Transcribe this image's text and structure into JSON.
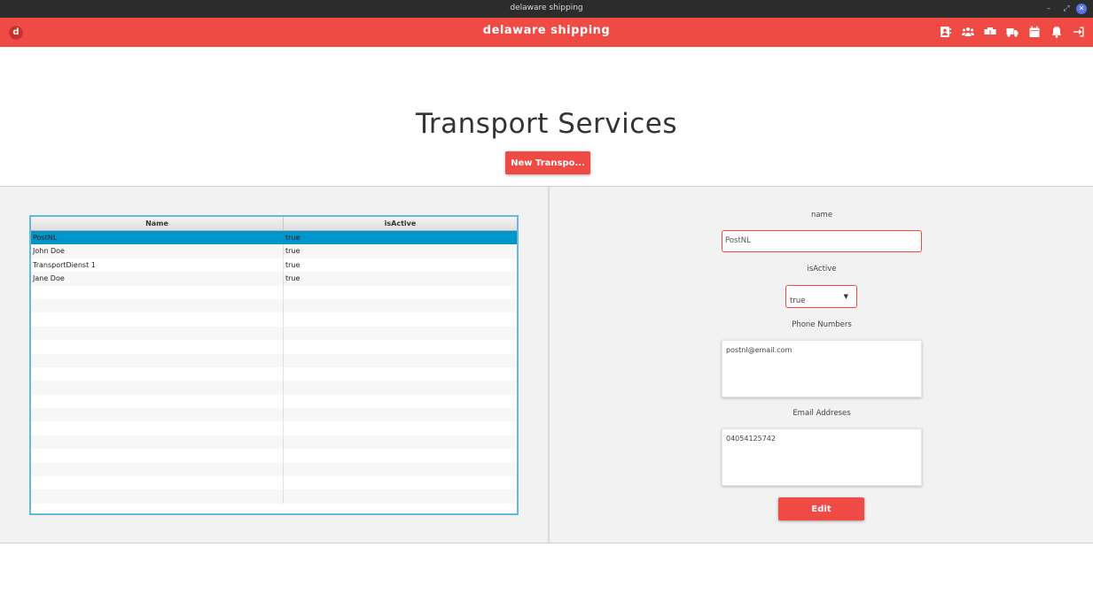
{
  "os": {
    "window_title": "delaware shipping",
    "min_glyph": "–",
    "max_glyph": "⤢",
    "close_glyph": "✕"
  },
  "header": {
    "logo_letter": "d",
    "title": "delaware shipping",
    "icons": [
      "contacts-icon",
      "users-icon",
      "boxes-icon",
      "truck-icon",
      "calendar-icon",
      "bell-icon",
      "logout-icon"
    ]
  },
  "page": {
    "title": "Transport Services",
    "new_button": "New Transpo..."
  },
  "table": {
    "columns": [
      "Name",
      "isActive"
    ],
    "rows": [
      {
        "name": "PostNL",
        "isActive": "true"
      },
      {
        "name": "John Doe",
        "isActive": "true"
      },
      {
        "name": "TransportDienst 1",
        "isActive": "true"
      },
      {
        "name": "Jane Doe",
        "isActive": "true"
      }
    ],
    "selected_index": 0
  },
  "form": {
    "name_label": "name",
    "name_value": "PostNL",
    "active_label": "isActive",
    "active_value": "true",
    "phone_label": "Phone Numbers",
    "phone_value": "postnl@email.com",
    "email_label": "Email Addreses",
    "email_value": "04054125742",
    "edit_button": "Edit"
  },
  "colors": {
    "accent": "#ef4a44",
    "selection": "#0096c9",
    "table_border": "#63b9db"
  }
}
